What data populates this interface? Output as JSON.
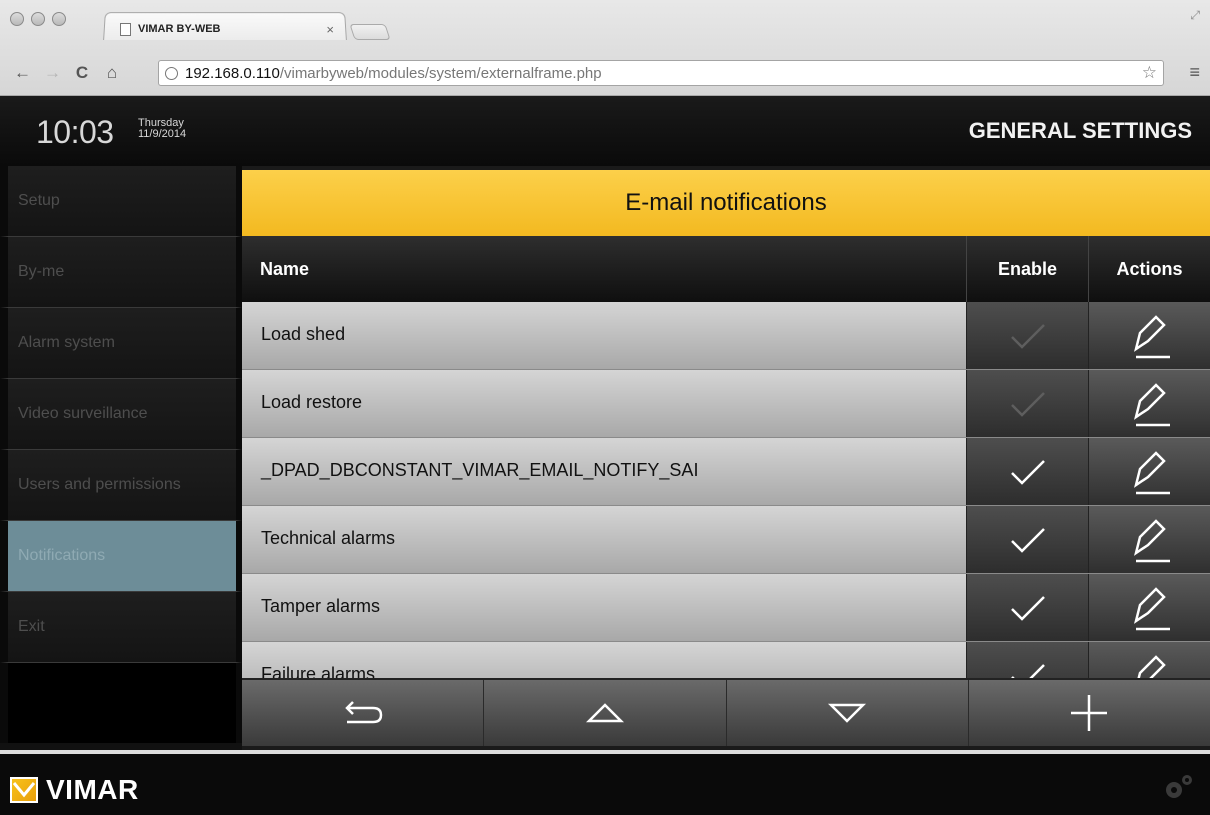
{
  "browser": {
    "tab_title": "VIMAR BY-WEB",
    "tab_close": "×",
    "url_host": "192.168.0.110",
    "url_path": "/vimarbyweb/modules/system/externalframe.php"
  },
  "header": {
    "time": "10:03",
    "day": "Thursday",
    "date": "11/9/2014",
    "title": "GENERAL SETTINGS"
  },
  "sidebar": {
    "items": [
      {
        "label": "Setup"
      },
      {
        "label": "By-me"
      },
      {
        "label": "Alarm system"
      },
      {
        "label": "Video surveillance"
      },
      {
        "label": "Users and permissions"
      },
      {
        "label": "Notifications"
      },
      {
        "label": "Exit"
      }
    ]
  },
  "main": {
    "banner": "E-mail notifications",
    "columns": {
      "name": "Name",
      "enable": "Enable",
      "actions": "Actions"
    },
    "rows": [
      {
        "name": "Load shed",
        "enabled": false
      },
      {
        "name": "Load restore",
        "enabled": false
      },
      {
        "name": "_DPAD_DBCONSTANT_VIMAR_EMAIL_NOTIFY_SAI",
        "enabled": true
      },
      {
        "name": "Technical alarms",
        "enabled": true
      },
      {
        "name": "Tamper alarms",
        "enabled": true
      },
      {
        "name": "Failure alarms",
        "enabled": true
      }
    ]
  },
  "footer": {
    "brand": "VIMAR"
  }
}
